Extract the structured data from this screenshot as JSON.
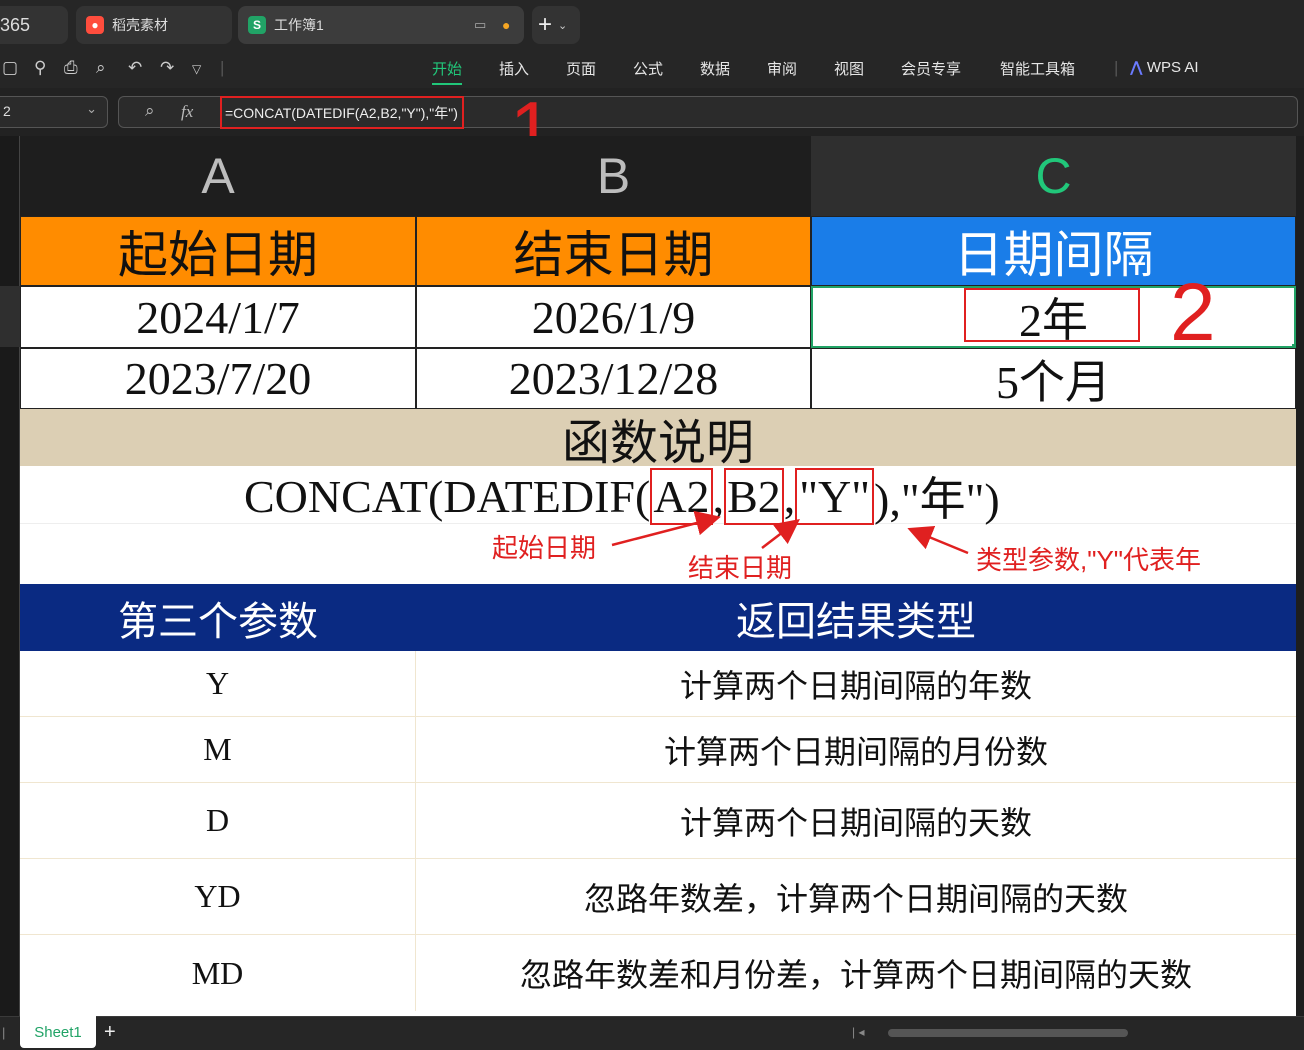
{
  "tabs": [
    {
      "label": "365"
    },
    {
      "label": "稻壳素材"
    },
    {
      "label": "工作簿1"
    }
  ],
  "new_tab": "+",
  "ribbon_menu": [
    "开始",
    "插入",
    "页面",
    "公式",
    "数据",
    "审阅",
    "视图",
    "会员专享",
    "智能工具箱"
  ],
  "wps_ai": "WPS AI",
  "name_box": "2",
  "fx": "fx",
  "formula": "=CONCAT(DATEDIF(A2,B2,\"Y\"),\"年\")",
  "columns": [
    "A",
    "B",
    "C"
  ],
  "table1": {
    "headers": [
      "起始日期",
      "结束日期",
      "日期间隔"
    ],
    "rows": [
      [
        "2024/1/7",
        "2026/1/9",
        "2年"
      ],
      [
        "2023/7/20",
        "2023/12/28",
        "5个月"
      ]
    ]
  },
  "explain": {
    "title": "函数说明",
    "formula_prefix": "CONCAT(DATEDIF(",
    "arg1": "A2",
    "comma1": ",",
    "arg2": "B2",
    "comma2": ",",
    "arg3": "\"Y\"",
    "formula_suffix": "),\"年\")",
    "ann_start": "起始日期",
    "ann_end": "结束日期",
    "ann_type": "类型参数,\"Y\"代表年"
  },
  "table2": {
    "headers": [
      "第三个参数",
      "返回结果类型"
    ],
    "rows": [
      [
        "Y",
        "计算两个日期间隔的年数"
      ],
      [
        "M",
        "计算两个日期间隔的月份数"
      ],
      [
        "D",
        "计算两个日期间隔的天数"
      ],
      [
        "YD",
        "忽路年数差，计算两个日期间隔的天数"
      ],
      [
        "MD",
        "忽路年数差和月份差，计算两个日期间隔的天数"
      ]
    ]
  },
  "markers": [
    "1",
    "2"
  ],
  "sheet_tab": "Sheet1",
  "add_sheet": "+",
  "colors": {
    "orange": "#ff8c00",
    "blue": "#1a7de8",
    "tan": "#dccfb4",
    "navy": "#0a2a82",
    "green": "#21c77a",
    "red": "#e02020"
  }
}
